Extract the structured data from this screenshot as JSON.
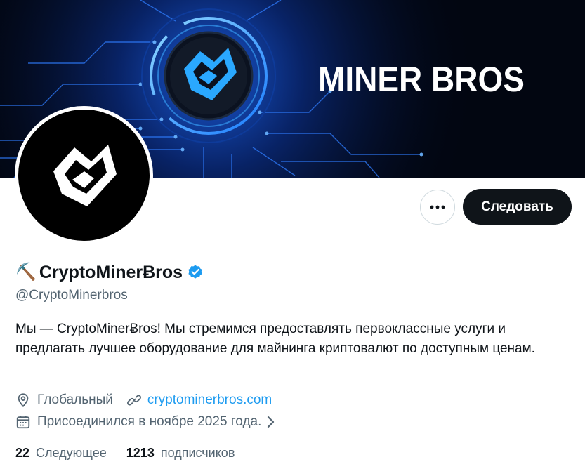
{
  "banner": {
    "title": "MINER BROS"
  },
  "actions": {
    "more_label": "•••",
    "follow_label": "Следовать"
  },
  "profile": {
    "emoji": "⛏️",
    "display_name": "CryptoMinerɃros",
    "handle": "@CryptoMinerbros",
    "bio": "Мы — CryptoMinerɃros! Мы стремимся предоставлять первоклассные услуги и предлагать лучшее оборудование для майнинга криптовалют по доступным ценам.",
    "location": "Глобальный",
    "website": "cryptominerbros.com",
    "joined": "Присоединился в ноябре 2025 года."
  },
  "stats": {
    "following_count": "22",
    "following_label": "Следующее",
    "followers_count": "1213",
    "followers_label": "подписчиков"
  },
  "colors": {
    "accent": "#1d9bf0",
    "text": "#0f1419",
    "muted": "#536471",
    "banner_glow": "#1e6fff"
  },
  "icons": [
    "more-dots-icon",
    "verified-badge-icon",
    "location-pin-icon",
    "link-icon",
    "calendar-icon",
    "chevron-right-icon",
    "miner-bros-logo"
  ]
}
